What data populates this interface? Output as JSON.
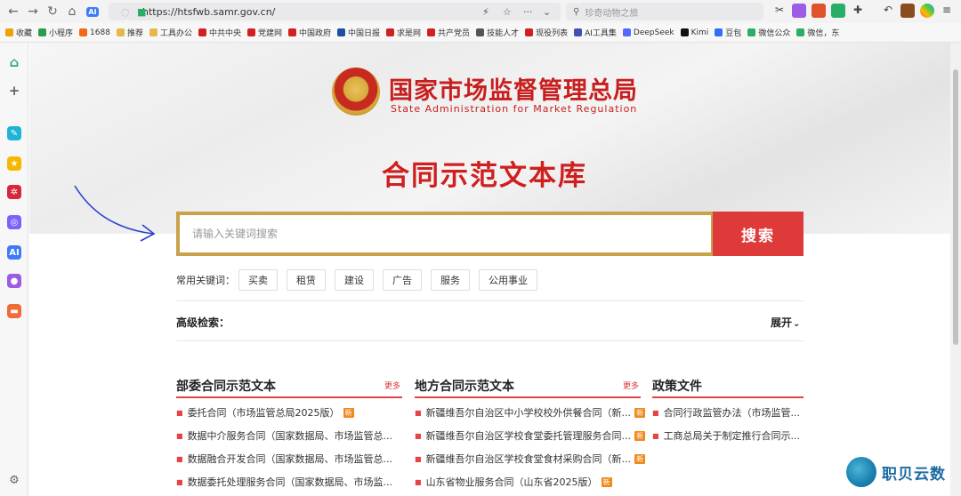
{
  "browser": {
    "url": "https://htsfwb.samr.gov.cn/",
    "search_placeholder": "珍奇动物之旅",
    "bookmarks": [
      {
        "label": "收藏",
        "color": "#e8a400"
      },
      {
        "label": "小程序",
        "color": "#2a9d4a"
      },
      {
        "label": "1688",
        "color": "#f06a1a"
      },
      {
        "label": "推荐",
        "color": "#e6b84c"
      },
      {
        "label": "工具办公",
        "color": "#e6b84c"
      },
      {
        "label": "中共中央",
        "color": "#d02020"
      },
      {
        "label": "党建网",
        "color": "#d02020"
      },
      {
        "label": "中国政府",
        "color": "#d02020"
      },
      {
        "label": "中国日报",
        "color": "#1c4fa0"
      },
      {
        "label": "求是网",
        "color": "#d02020"
      },
      {
        "label": "共产党员",
        "color": "#d02020"
      },
      {
        "label": "技能人才",
        "color": "#555555"
      },
      {
        "label": "现役列表",
        "color": "#d02020"
      },
      {
        "label": "AI工具集",
        "color": "#3f51b5"
      },
      {
        "label": "DeepSeek",
        "color": "#4d6bfe"
      },
      {
        "label": "Kimi",
        "color": "#111111"
      },
      {
        "label": "豆包",
        "color": "#2f6ef5"
      },
      {
        "label": "微信公众",
        "color": "#2aae67"
      },
      {
        "label": "微信，东",
        "color": "#2aae67"
      }
    ]
  },
  "sidebar": {
    "icons": [
      {
        "name": "home-icon",
        "color": "#2aae67",
        "glyph": "⌂"
      },
      {
        "name": "plus-icon",
        "color": "#666666",
        "glyph": "+"
      },
      {
        "name": "app-icon-1",
        "color": "#1fb3d6",
        "glyph": "✎"
      },
      {
        "name": "star-icon",
        "color": "#f5b700",
        "glyph": "★"
      },
      {
        "name": "app-icon-2",
        "color": "#d7263d",
        "glyph": "✲"
      },
      {
        "name": "app-icon-3",
        "color": "#7b61ff",
        "glyph": "◎"
      },
      {
        "name": "ai-icon",
        "color": "#3d7bf7",
        "glyph": "AI"
      },
      {
        "name": "robot-icon",
        "color": "#9b5de5",
        "glyph": "●"
      },
      {
        "name": "game-icon",
        "color": "#ef6c3a",
        "glyph": "▬"
      }
    ]
  },
  "header": {
    "agency_cn": "国家市场监督管理总局",
    "agency_en": "State Administration for Market Regulation",
    "library_title": "合同示范文本库"
  },
  "search": {
    "placeholder": "请输入关键词搜索",
    "button": "搜索"
  },
  "keywords": {
    "label": "常用关键词：",
    "tags": [
      "买卖",
      "租赁",
      "建设",
      "广告",
      "服务",
      "公用事业"
    ]
  },
  "advanced": {
    "label": "高级检索：",
    "expand": "展开"
  },
  "columns": [
    {
      "title": "部委合同示范文本",
      "more": "更多",
      "items": [
        {
          "text": "委托合同（市场监管总局2025版）",
          "new": "新"
        },
        {
          "text": "数据中介服务合同（国家数据局、市场监管总...",
          "new": ""
        },
        {
          "text": "数据融合开发合同（国家数据局、市场监管总...",
          "new": ""
        },
        {
          "text": "数据委托处理服务合同（国家数据局、市场监...",
          "new": ""
        }
      ]
    },
    {
      "title": "地方合同示范文本",
      "more": "更多",
      "items": [
        {
          "text": "新疆维吾尔自治区中小学校校外供餐合同（新...",
          "new": "新"
        },
        {
          "text": "新疆维吾尔自治区学校食堂委托管理服务合同...",
          "new": "新"
        },
        {
          "text": "新疆维吾尔自治区学校食堂食材采购合同（新...",
          "new": "新"
        },
        {
          "text": "山东省物业服务合同（山东省2025版）",
          "new": "新"
        }
      ]
    },
    {
      "title": "政策文件",
      "more": "",
      "items": [
        {
          "text": "合同行政监管办法（市场监管...",
          "new": ""
        },
        {
          "text": "工商总局关于制定推行合同示...",
          "new": ""
        }
      ]
    }
  ],
  "watermark": {
    "text": "职贝云数"
  }
}
